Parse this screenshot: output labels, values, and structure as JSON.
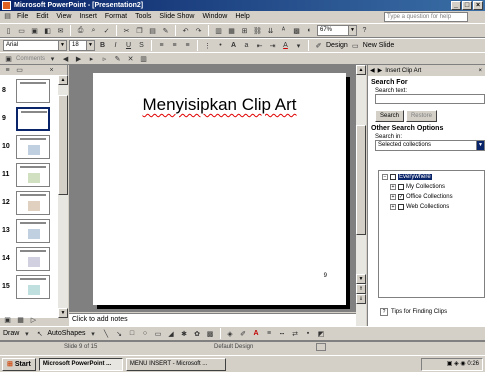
{
  "window": {
    "title": "Microsoft PowerPoint - [Presentation2]"
  },
  "menu": {
    "items": [
      "File",
      "Edit",
      "View",
      "Insert",
      "Format",
      "Tools",
      "Slide Show",
      "Window",
      "Help"
    ],
    "help_placeholder": "Type a question for help"
  },
  "formatting": {
    "font": "Arial",
    "size": "18",
    "zoom": "67%",
    "design_label": "Design",
    "new_slide_label": "New Slide"
  },
  "outline_toolbar": {
    "label": "Comments"
  },
  "slides_panel": {
    "tabs": [
      "Outline",
      "Slides"
    ],
    "slides": [
      "8",
      "9",
      "10",
      "11",
      "12",
      "13",
      "14",
      "15"
    ],
    "selected": "9"
  },
  "slide": {
    "title": "Menyisipkan Clip Art",
    "page_number": "9"
  },
  "notes": {
    "placeholder": "Click to add notes"
  },
  "task_pane": {
    "title": "Insert Clip Art",
    "search_for": "Search For",
    "search_text_label": "Search text:",
    "search_value": "",
    "search_button": "Search",
    "restore_button": "Restore",
    "other_options": "Other Search Options",
    "search_in_label": "Search in:",
    "search_in_value": "Selected collections",
    "tree": [
      {
        "label": "Everywhere",
        "level": 0,
        "state": "selected"
      },
      {
        "label": "My Collections",
        "level": 1,
        "state": "unchecked"
      },
      {
        "label": "Office Collections",
        "level": 1,
        "state": "checked"
      },
      {
        "label": "Web Collections",
        "level": 1,
        "state": "unchecked"
      }
    ],
    "tips_label": "Tips for Finding Clips"
  },
  "drawing": {
    "draw_label": "Draw",
    "autoshapes_label": "AutoShapes"
  },
  "status": {
    "slide_info": "Slide 9 of 15",
    "design": "Default Design"
  },
  "taskbar": {
    "start": "Start",
    "items": [
      "Microsoft PowerPoint ...",
      "MENU INSERT - Microsoft ..."
    ],
    "clock": "0:26"
  },
  "colors": {
    "title_bar": "#0a246a",
    "spelling_underline": "#e00000",
    "selection": "#0a246a"
  }
}
